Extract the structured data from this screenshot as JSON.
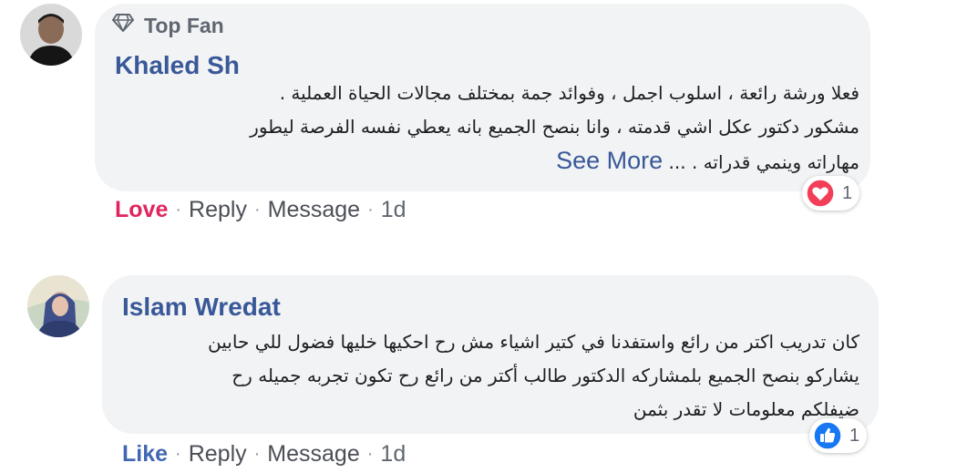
{
  "comments": [
    {
      "badge": "Top Fan",
      "author": "Khaled Sh",
      "lines": [
        "فعلا ورشة رائعة ، اسلوب اجمل ، وفوائد جمة بمختلف مجالات الحياة العملية .",
        "مشكور دكتور عكل اشي قدمته ، وانا بنصح الجميع بانه يعطي نفسه الفرصة ليطور",
        "مهاراته وينمي قدراته . ..."
      ],
      "see_more": "See More",
      "reaction_icon": "love-icon",
      "reaction_count": "1",
      "actions": {
        "react": "Love",
        "reply": "Reply",
        "message": "Message",
        "time": "1d"
      }
    },
    {
      "author": "Islam Wredat",
      "lines": [
        "كان تدريب اكتر من رائع واستفدنا في كتير اشياء مش رح احكيها خليها فضول للي حابين",
        "يشاركو بنصح الجميع بلمشاركه الدكتور طالب أكتر من رائع رح تكون تجربه جميله رح",
        "ضيفلكم معلومات لا تقدر بثمن"
      ],
      "reaction_icon": "like-icon",
      "reaction_count": "1",
      "actions": {
        "react": "Like",
        "reply": "Reply",
        "message": "Message",
        "time": "1d"
      }
    }
  ],
  "separator": "·",
  "colors": {
    "bubble": "#f2f3f5",
    "author": "#385898",
    "love": "#e0245e",
    "like": "#4267b2",
    "meta": "#606770"
  }
}
